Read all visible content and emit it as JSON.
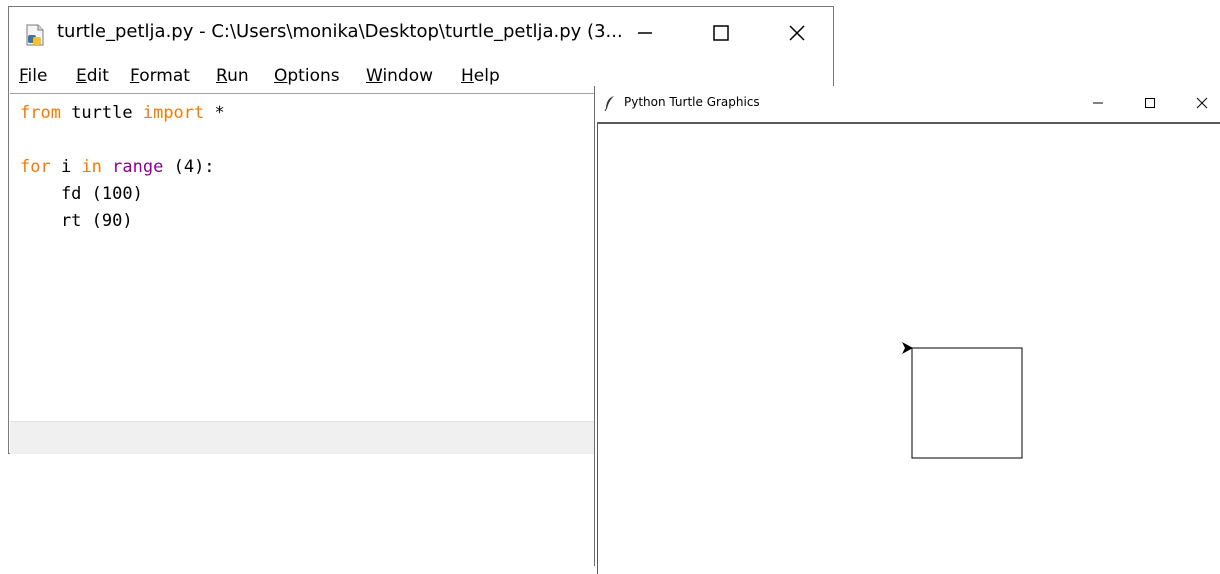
{
  "idle_window": {
    "title": "turtle_petlja.py - C:\\Users\\monika\\Desktop\\turtle_petlja.py (3...",
    "menu": [
      "File",
      "Edit",
      "Format",
      "Run",
      "Options",
      "Window",
      "Help"
    ],
    "code": {
      "line1": {
        "kw1": "from",
        "mid": " turtle ",
        "kw2": "import",
        "rest": " *"
      },
      "line3": {
        "kw1": "for",
        "mid": " i ",
        "kw2": "in",
        "mid2": " ",
        "builtin": "range",
        "rest": " (4):"
      },
      "line4": "    fd (100)",
      "line5": "    rt (90)"
    }
  },
  "turtle_window": {
    "title": "Python Turtle Graphics",
    "drawing": {
      "shape": "square",
      "side": 100,
      "turn_deg": 90,
      "repeats": 4
    }
  },
  "colors": {
    "keyword": "#ff7700",
    "builtin": "#900090",
    "text": "#000000"
  },
  "icons": {
    "idle_app": "idle-python-file-icon",
    "turtle_app": "feather-icon",
    "minimize": "minimize-icon",
    "maximize": "maximize-icon",
    "close": "close-icon",
    "turtle_cursor": "turtle-arrow-icon"
  }
}
